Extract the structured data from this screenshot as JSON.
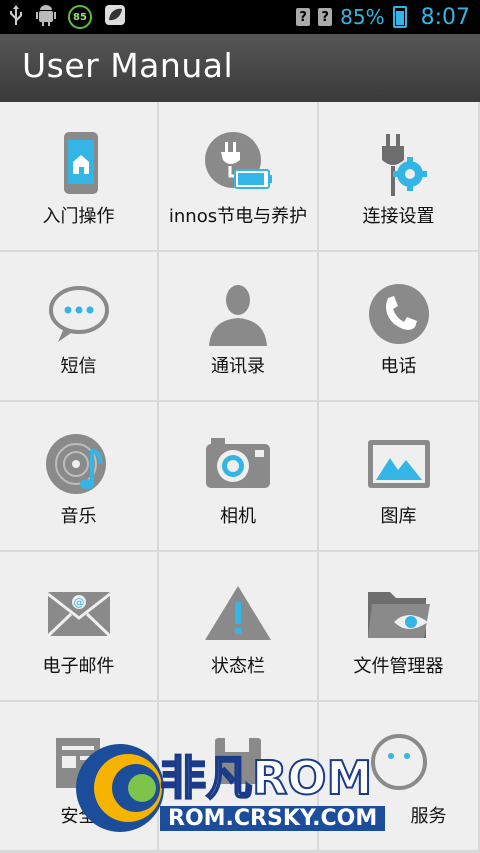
{
  "status_bar": {
    "battery_badge": "85",
    "battery_percent": "85%",
    "time": "8:07",
    "accent_color": "#33b5e5"
  },
  "header": {
    "title": "User Manual"
  },
  "grid": [
    {
      "label": "入门操作",
      "icon": "phone-home-icon"
    },
    {
      "label": "innos节电与养护",
      "icon": "power-plug-battery-icon"
    },
    {
      "label": "连接设置",
      "icon": "plug-gear-icon"
    },
    {
      "label": "短信",
      "icon": "chat-bubble-icon"
    },
    {
      "label": "通讯录",
      "icon": "person-icon"
    },
    {
      "label": "电话",
      "icon": "phone-call-icon"
    },
    {
      "label": "音乐",
      "icon": "music-disc-icon"
    },
    {
      "label": "相机",
      "icon": "camera-icon"
    },
    {
      "label": "图库",
      "icon": "gallery-icon"
    },
    {
      "label": "电子邮件",
      "icon": "email-icon"
    },
    {
      "label": "状态栏",
      "icon": "warning-icon"
    },
    {
      "label": "文件管理器",
      "icon": "folder-eye-icon"
    },
    {
      "label": "安全",
      "icon": "document-icon"
    },
    {
      "label": "",
      "icon": "save-icon"
    },
    {
      "label": "服务",
      "icon": "smiley-icon"
    }
  ],
  "watermark": {
    "brand": "非凡ROM",
    "site": "ROM.CRSKY.COM"
  }
}
